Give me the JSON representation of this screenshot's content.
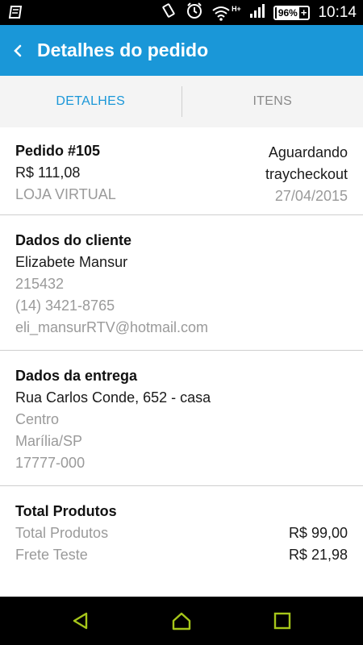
{
  "status_bar": {
    "battery": "96%",
    "time": "10:14",
    "network": "H+"
  },
  "app_bar": {
    "title": "Detalhes do pedido"
  },
  "tabs": [
    {
      "label": "DETALHES",
      "active": true
    },
    {
      "label": "ITENS",
      "active": false
    }
  ],
  "order": {
    "number": "Pedido #105",
    "total": "R$ 111,08",
    "store": "LOJA VIRTUAL",
    "status_line1": "Aguardando",
    "status_line2": "traycheckout",
    "date": "27/04/2015"
  },
  "client": {
    "heading": "Dados do cliente",
    "name": "Elizabete Mansur",
    "id": "215432",
    "phone": "(14) 3421-8765",
    "email": "eli_mansurRTV@hotmail.com"
  },
  "delivery": {
    "heading": "Dados da entrega",
    "street": "Rua Carlos Conde, 652 - casa",
    "district": "Centro",
    "city": "Marília/SP",
    "zip": "17777-000"
  },
  "totals": {
    "heading": "Total Produtos",
    "rows": [
      {
        "label": "Total Produtos",
        "value": "R$ 99,00"
      },
      {
        "label": "Frete Teste",
        "value": "R$ 21,98"
      }
    ]
  },
  "colors": {
    "accent": "#1a97d8"
  },
  "icons": {
    "back": "back-arrow-icon",
    "nav_back": "nav-back-triangle-icon",
    "nav_home": "nav-home-icon",
    "nav_recents": "nav-recents-square-icon"
  }
}
